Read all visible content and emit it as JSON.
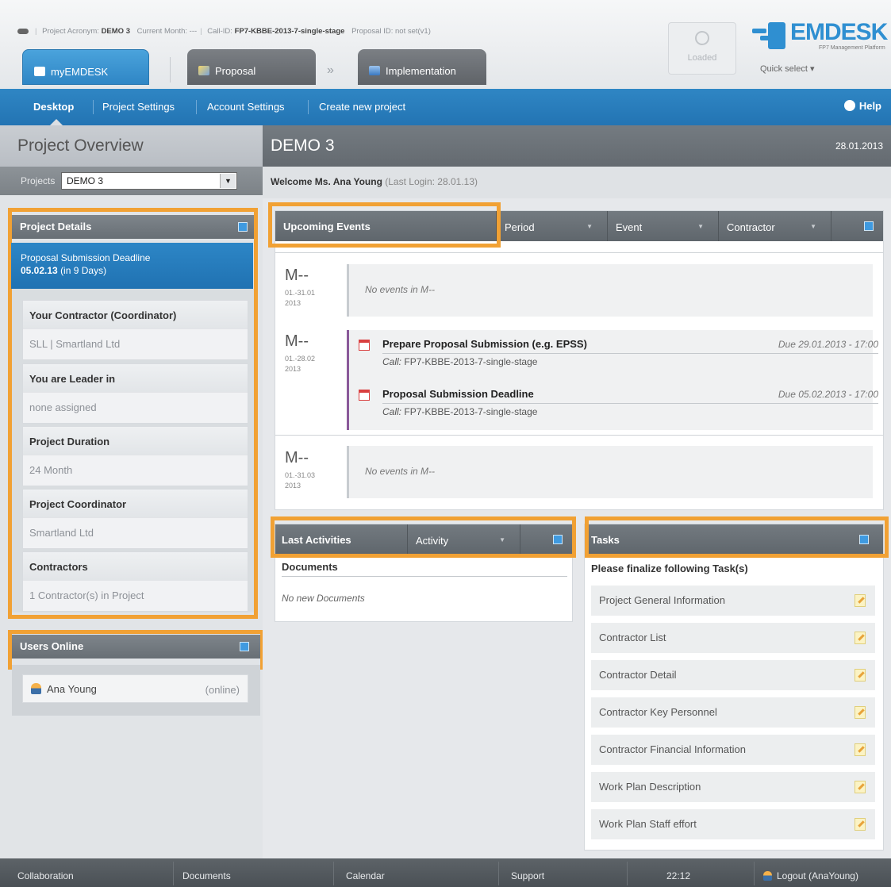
{
  "header": {
    "info": {
      "acronym_label": "Project Acronym:",
      "acronym": "DEMO 3",
      "month_label": "Current Month:",
      "month": "---",
      "call_label": "Call-ID:",
      "call": "FP7-KBBE-2013-7-single-stage",
      "proposal_label": "Proposal ID:",
      "proposal": "not set(v1)"
    },
    "tabs": {
      "my": "myEMDESK",
      "proposal": "Proposal",
      "implementation": "Implementation",
      "arrow": "»"
    },
    "loaded": "Loaded",
    "logo": {
      "text": "EMDESK",
      "subtitle": "FP7 Management Platform"
    },
    "quick_select": "Quick select ▾"
  },
  "nav": {
    "items": [
      "Desktop",
      "Project Settings",
      "Account Settings",
      "Create new project"
    ],
    "help": "Help"
  },
  "left": {
    "title": "Project Overview",
    "projects_label": "Projects",
    "project_selected": "DEMO 3",
    "project_details": {
      "title": "Project Details",
      "deadline_label": "Proposal Submission Deadline",
      "deadline_date": "05.02.13",
      "deadline_rest": "(in 9 Days)",
      "rows": [
        {
          "label": "Your Contractor (Coordinator)",
          "value": "SLL | Smartland Ltd"
        },
        {
          "label": "You are Leader in",
          "value": "none assigned"
        },
        {
          "label": "Project Duration",
          "value": "24 Month"
        },
        {
          "label": "Project Coordinator",
          "value": "Smartland Ltd"
        },
        {
          "label": "Contractors",
          "value": "1 Contractor(s) in Project"
        }
      ]
    },
    "users_online": {
      "title": "Users Online",
      "user": "Ana Young",
      "status": "(online)"
    }
  },
  "main": {
    "title": "DEMO 3",
    "date": "28.01.2013",
    "welcome": "Welcome Ms. Ana Young",
    "last_login": "(Last Login: 28.01.13)",
    "upcoming": {
      "title": "Upcoming Events",
      "filters": [
        "Period",
        "Event",
        "Contractor"
      ],
      "months": [
        {
          "m": "M--",
          "range": "01.-31.01",
          "year": "2013",
          "empty": "No events in M--"
        },
        {
          "m": "M--",
          "range": "01.-28.02",
          "year": "2013"
        },
        {
          "m": "M--",
          "range": "01.-31.03",
          "year": "2013",
          "empty": "No events in M--"
        }
      ],
      "events": [
        {
          "title": "Prepare Proposal Submission (e.g. EPSS)",
          "due": "Due 29.01.2013 - 17:00",
          "call_label": "Call:",
          "call": "FP7-KBBE-2013-7-single-stage"
        },
        {
          "title": "Proposal Submission Deadline",
          "due": "Due 05.02.2013 - 17:00",
          "call_label": "Call:",
          "call": "FP7-KBBE-2013-7-single-stage"
        }
      ]
    },
    "activities": {
      "title": "Last Activities",
      "filter": "Activity",
      "section": "Documents",
      "empty": "No new Documents"
    },
    "tasks": {
      "title": "Tasks",
      "intro": "Please finalize following Task(s)",
      "items": [
        "Project General Information",
        "Contractor List",
        "Contractor Detail",
        "Contractor Key Personnel",
        "Contractor Financial Information",
        "Work Plan Description",
        "Work Plan Staff effort"
      ]
    }
  },
  "footer": {
    "items": [
      "Collaboration",
      "Documents",
      "Calendar",
      "Support"
    ],
    "time": "22:12",
    "logout": "Logout (AnaYoung)"
  },
  "colors": {
    "accent_blue": "#2f86c4",
    "highlight_orange": "#f1a134",
    "panel_gray": "#6b7278"
  }
}
